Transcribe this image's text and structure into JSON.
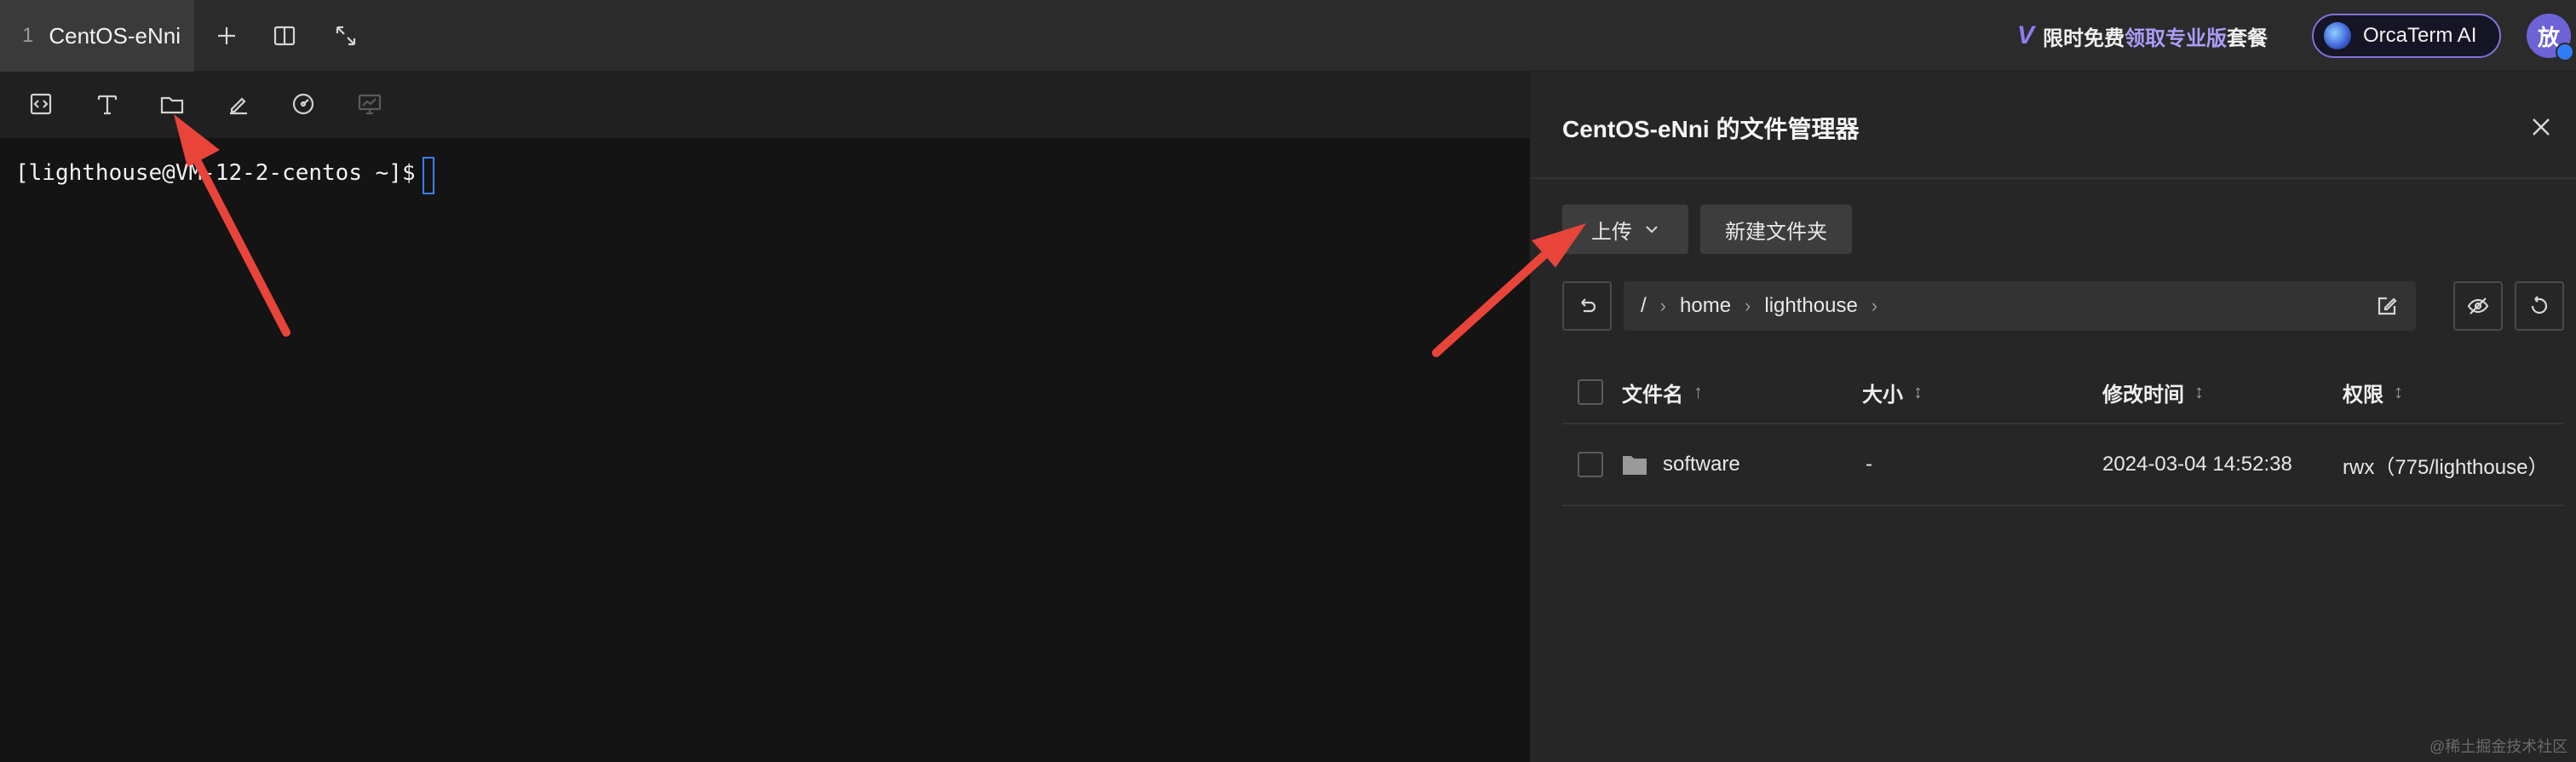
{
  "topbar": {
    "tab": {
      "index": "1",
      "title": "CentOS-eNni"
    },
    "icons": {
      "add": "plus-icon",
      "split": "split-view-icon",
      "fullscreen": "expand-icon"
    },
    "promo": {
      "logo": "V",
      "part1": "限时免费",
      "part2": "领取专业版",
      "part3": "套餐"
    },
    "orcaterm": {
      "label": "OrcaTerm AI"
    },
    "avatar": {
      "text": "放"
    }
  },
  "toolbar": {
    "tools": [
      "code-icon",
      "text-icon",
      "folder-icon",
      "pen-icon",
      "gauge-icon",
      "monitor-icon"
    ]
  },
  "terminal": {
    "prompt": "[lighthouse@VM-12-2-centos ~]$"
  },
  "file_manager": {
    "title": "CentOS-eNni 的文件管理器",
    "upload_label": "上传",
    "new_folder_label": "新建文件夹",
    "path": [
      "/",
      "home",
      "lighthouse"
    ],
    "columns": {
      "name": "文件名",
      "size": "大小",
      "modified": "修改时间",
      "permissions": "权限"
    },
    "rows": [
      {
        "name": "software",
        "size": "-",
        "modified": "2024-03-04 14:52:38",
        "permissions": "rwx（775/lighthouse）"
      }
    ]
  },
  "watermark": "@稀土掘金技术社区",
  "colors": {
    "accent": "#8d7cf5",
    "arrow": "#e8443a",
    "cursor": "#3d7ef5"
  }
}
